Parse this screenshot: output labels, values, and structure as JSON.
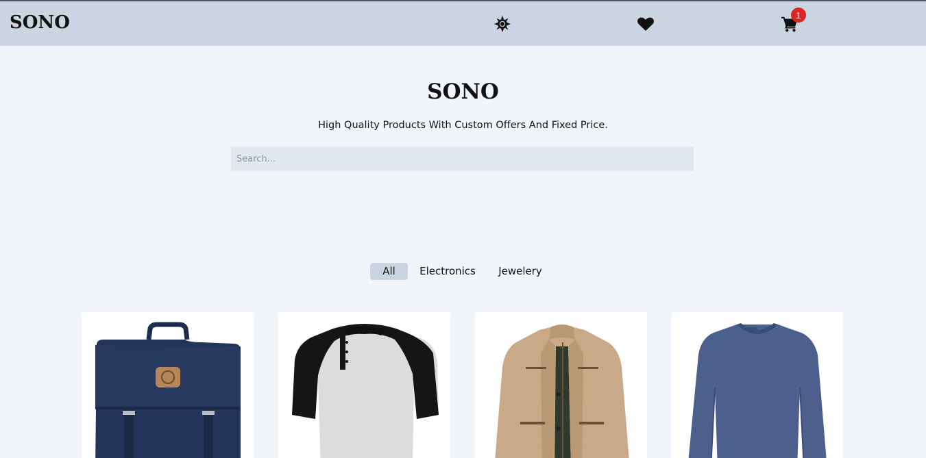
{
  "header": {
    "brand": "SONO",
    "icons": [
      "sun-icon",
      "heart-icon",
      "cart-icon"
    ],
    "cart_count": "1"
  },
  "hero": {
    "title": "SONO",
    "subtitle": "High Quality Products With Custom Offers And Fixed Price.",
    "search_placeholder": "Search..."
  },
  "categories": [
    {
      "label": "All",
      "active": true
    },
    {
      "label": "Electronics",
      "active": false
    },
    {
      "label": "Jewelery",
      "active": false
    }
  ],
  "products": [
    {
      "image": "backpack"
    },
    {
      "image": "raglan-tshirt"
    },
    {
      "image": "jacket"
    },
    {
      "image": "long-sleeve-shirt"
    }
  ],
  "colors": {
    "header_bg": "#cbd5e1",
    "page_bg": "#f1f4f9",
    "search_bg": "#e2e8f0",
    "badge": "#dc2626",
    "active_tab": "#cbd5e1"
  }
}
